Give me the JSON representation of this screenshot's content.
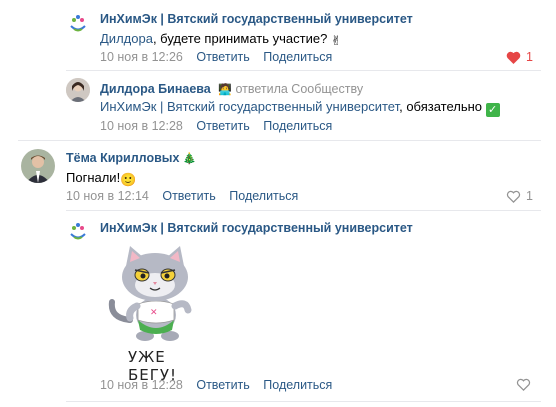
{
  "comments": [
    {
      "author": "ИнХимЭк | Вятский государственный университет",
      "text_mention": "Дилдора",
      "text_rest": ", будете принимать участие? ",
      "emoji": "✌",
      "time": "10 ноя в 12:26",
      "reply": "Ответить",
      "share": "Поделиться",
      "likes": "1",
      "liked": true
    },
    {
      "author": "Дилдора Бинаева",
      "reply_badge": "ответила Сообществу",
      "text_mention": "ИнХимЭк | Вятский государственный университет",
      "text_rest": ", обязательно ",
      "emoji": "✅",
      "time": "10 ноя в 12:28",
      "reply": "Ответить",
      "share": "Поделиться"
    },
    {
      "author": "Тёма Кирилловых",
      "text_rest": "Погнали!",
      "emoji": "🙂",
      "time": "10 ноя в 12:14",
      "reply": "Ответить",
      "share": "Поделиться",
      "likes": "1",
      "liked": false
    },
    {
      "author": "ИнХимЭк | Вятский государственный университет",
      "sticker_caption": "УЖЕ БЕГУ!",
      "time": "10 ноя в 12:28",
      "reply": "Ответить",
      "share": "Поделиться"
    }
  ],
  "colors": {
    "link": "#2a5885",
    "meta": "#939393",
    "like_active": "#e64646"
  }
}
